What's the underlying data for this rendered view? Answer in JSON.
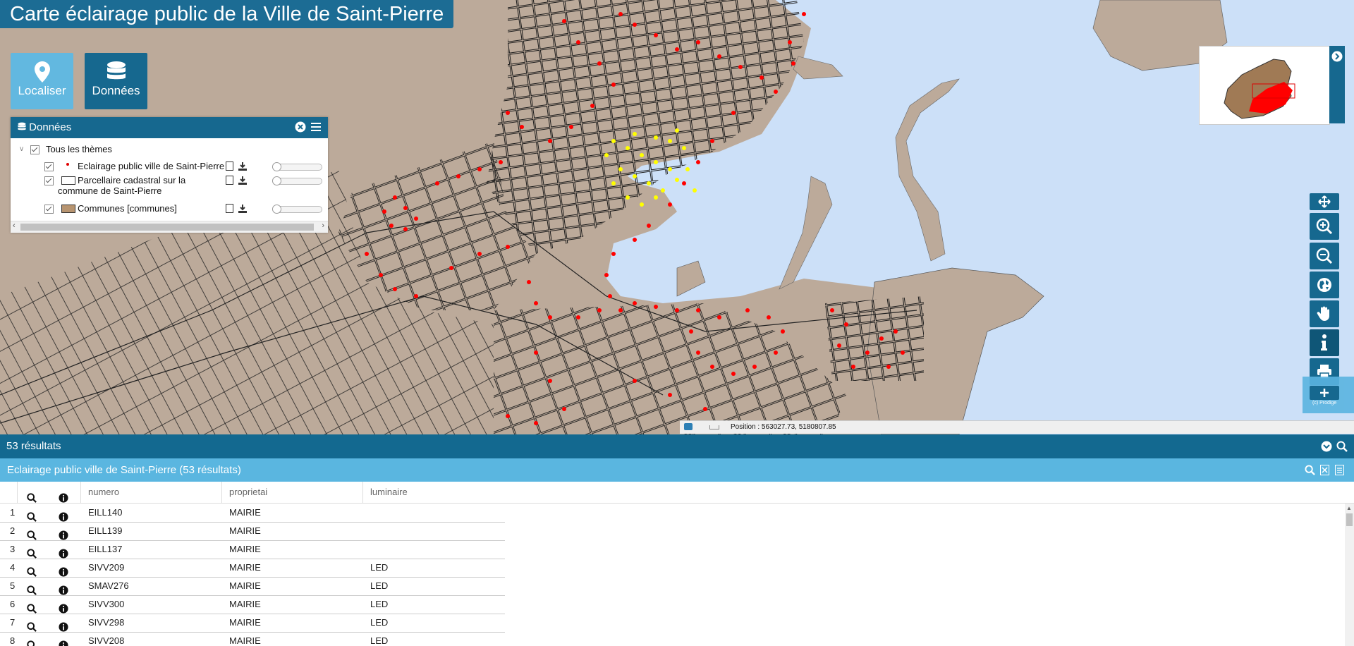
{
  "app": {
    "title": "Carte éclairage public de la Ville de Saint-Pierre"
  },
  "top_buttons": [
    {
      "label": "Localiser",
      "icon": "map-marker-icon"
    },
    {
      "label": "Données",
      "icon": "database-icon"
    }
  ],
  "layers_panel": {
    "title": "Données",
    "root_label": "Tous les thèmes",
    "layers": [
      {
        "label": "Eclairage public ville de Saint-Pierre",
        "legend": "red-dot"
      },
      {
        "label": "Parcellaire cadastral sur la",
        "label2": "commune de Saint-Pierre",
        "legend": "white-rect"
      },
      {
        "label": "Communes [communes]",
        "legend": "brown-rect"
      }
    ]
  },
  "map": {
    "position_text": "Position : 563027.73, 5180807.85",
    "attribution": "(c) Prodige",
    "colors": {
      "land": "#bcaa9a",
      "sea": "#cce0f8",
      "light_point": "#ff0000",
      "selected_point": "#ffff00",
      "accent": "#16688f"
    }
  },
  "tools": [
    "pan-icon",
    "zoom-in-icon",
    "zoom-out-icon",
    "globe-icon",
    "hand-icon",
    "info-icon",
    "print-icon",
    "plus-icon"
  ],
  "results": {
    "count_label": "53 résultats",
    "layer_label": "Eclairage public ville de Saint-Pierre (53 résultats)",
    "columns": [
      "numero",
      "proprietai",
      "luminaire"
    ],
    "rows": [
      {
        "n": "1",
        "numero": "EILL140",
        "proprietai": "MAIRIE",
        "luminaire": ""
      },
      {
        "n": "2",
        "numero": "EILL139",
        "proprietai": "MAIRIE",
        "luminaire": ""
      },
      {
        "n": "3",
        "numero": "EILL137",
        "proprietai": "MAIRIE",
        "luminaire": ""
      },
      {
        "n": "4",
        "numero": "SIVV209",
        "proprietai": "MAIRIE",
        "luminaire": "LED"
      },
      {
        "n": "5",
        "numero": "SMAV276",
        "proprietai": "MAIRIE",
        "luminaire": "LED"
      },
      {
        "n": "6",
        "numero": "SIVV300",
        "proprietai": "MAIRIE",
        "luminaire": "LED"
      },
      {
        "n": "7",
        "numero": "SIVV298",
        "proprietai": "MAIRIE",
        "luminaire": "LED"
      },
      {
        "n": "8",
        "numero": "SIVV208",
        "proprietai": "MAIRIE",
        "luminaire": "LED"
      }
    ]
  }
}
